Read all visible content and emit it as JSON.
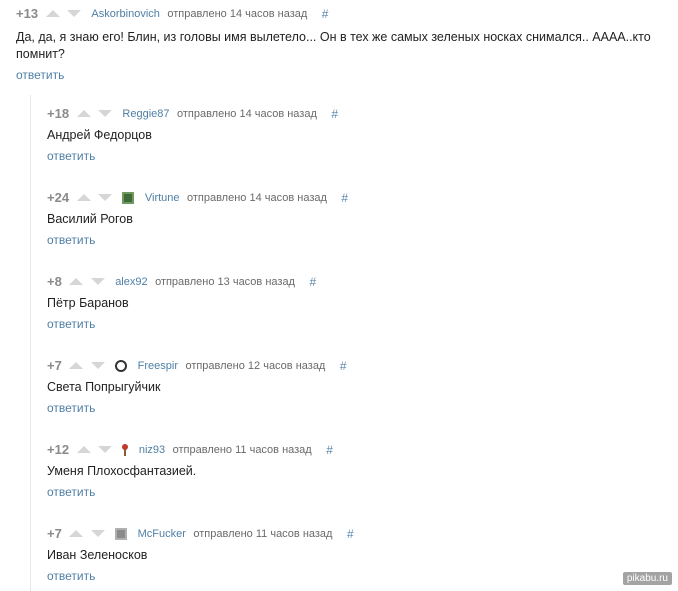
{
  "comments": [
    {
      "rating": "+13",
      "author": "Askorbinovich",
      "sent": "отправлено 14 часов назад",
      "hash": "#",
      "text": "Да, да, я знаю его! Блин, из головы имя вылетело... Он в тех же самых зеленых носках снимался.. АААА..кто помнит?",
      "reply": "ответить",
      "avatar": null
    },
    {
      "rating": "+18",
      "author": "Reggie87",
      "sent": "отправлено 14 часов назад",
      "hash": "#",
      "text": "Андрей Федорцов",
      "reply": "ответить",
      "avatar": null
    },
    {
      "rating": "+24",
      "author": "Virtune",
      "sent": "отправлено 14 часов назад",
      "hash": "#",
      "text": "Василий Рогов",
      "reply": "ответить",
      "avatar": "#3f6b3a"
    },
    {
      "rating": "+8",
      "author": "alex92",
      "sent": "отправлено 13 часов назад",
      "hash": "#",
      "text": "Пётр Баранов",
      "reply": "ответить",
      "avatar": null
    },
    {
      "rating": "+7",
      "author": "Freespir",
      "sent": "отправлено 12 часов назад",
      "hash": "#",
      "text": "Света Попрыгуйчик",
      "reply": "ответить",
      "avatar": "#333333"
    },
    {
      "rating": "+12",
      "author": "niz93",
      "sent": "отправлено 11 часов назад",
      "hash": "#",
      "text": "Уменя Плохосфантазией.",
      "reply": "ответить",
      "avatar": "#c0392b"
    },
    {
      "rating": "+7",
      "author": "McFucker",
      "sent": "отправлено 11 часов назад",
      "hash": "#",
      "text": "Иван Зеленосков",
      "reply": "ответить",
      "avatar": "#8a8a8a"
    }
  ],
  "watermark": "pikabu.ru",
  "colors": {
    "link": "#4e7fa6",
    "rating": "#8a8a8a",
    "vote_arrow": "#d6d6d6",
    "text": "#222222"
  }
}
